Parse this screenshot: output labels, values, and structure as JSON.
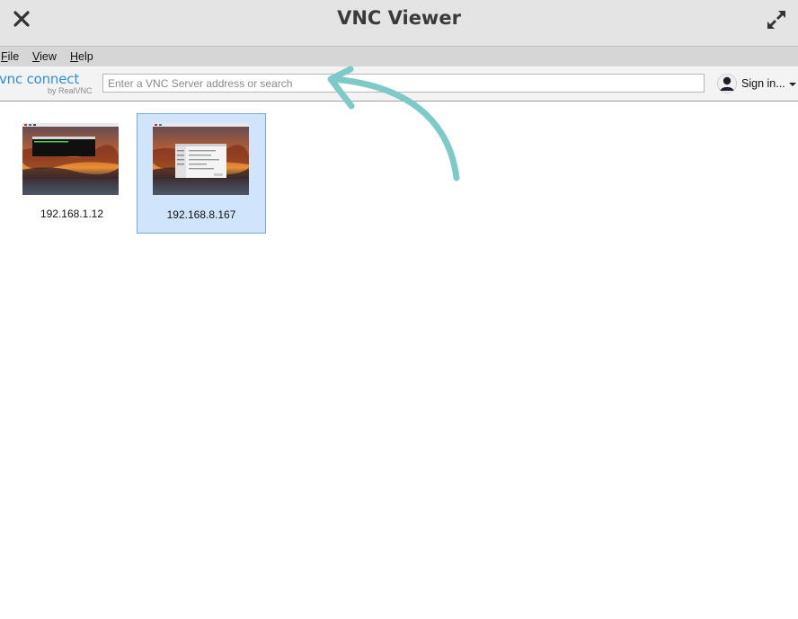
{
  "window": {
    "title": "VNC Viewer"
  },
  "icons": {
    "close": "close-icon",
    "expand": "expand-icon",
    "user": "user-icon",
    "caret": "caret-down-icon"
  },
  "menu": [
    {
      "label": "File",
      "accel": "F",
      "rest": "ile"
    },
    {
      "label": "View",
      "accel": "V",
      "rest": "iew"
    },
    {
      "label": "Help",
      "accel": "H",
      "rest": "elp"
    }
  ],
  "logo": {
    "main": "vnc connect",
    "sub": "by RealVNC"
  },
  "search": {
    "placeholder": "Enter a VNC Server address or search",
    "value": ""
  },
  "account": {
    "signin_label": "Sign in..."
  },
  "servers": [
    {
      "address": "192.168.1.12",
      "selected": false
    },
    {
      "address": "192.168.8.167",
      "selected": true
    }
  ],
  "colors": {
    "accent": "#2f8fd8",
    "selection": "#d0e4fb",
    "selection_border": "#79a9e0",
    "annotation_arrow": "#7ecac8"
  }
}
